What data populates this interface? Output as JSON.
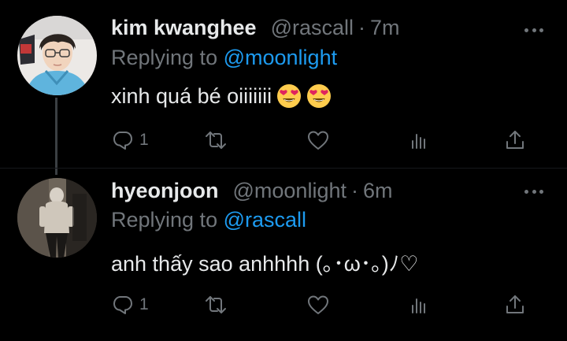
{
  "tweets": [
    {
      "display_name": "kim kwanghee",
      "handle": "@rascall",
      "separator": "·",
      "time": "7m",
      "replying_prefix": "Replying to",
      "replying_to": "@moonlight",
      "text": "xinh quá bé oiiiiiii",
      "emojis": [
        "heart-eyes-emoji",
        "heart-eyes-emoji"
      ],
      "reply_count": "1",
      "avatar": "avatar-photo"
    },
    {
      "display_name": "hyeonjoon",
      "handle": "@moonlight",
      "separator": "·",
      "time": "6m",
      "replying_prefix": "Replying to",
      "replying_to": "@rascall",
      "text": "anh thấy sao anhhhh (｡･ω･｡)ﾉ♡",
      "reply_count": "1",
      "avatar": "avatar-photo"
    }
  ],
  "icons": {
    "more": "more-horizontal-icon",
    "reply": "reply-icon",
    "retweet": "retweet-icon",
    "like": "heart-icon",
    "views": "views-icon",
    "share": "share-icon"
  },
  "colors": {
    "background": "#000000",
    "primary_text": "#e7e9ea",
    "secondary_text": "#71767b",
    "accent": "#1d9bf0",
    "thread_line": "#3b3f43"
  }
}
